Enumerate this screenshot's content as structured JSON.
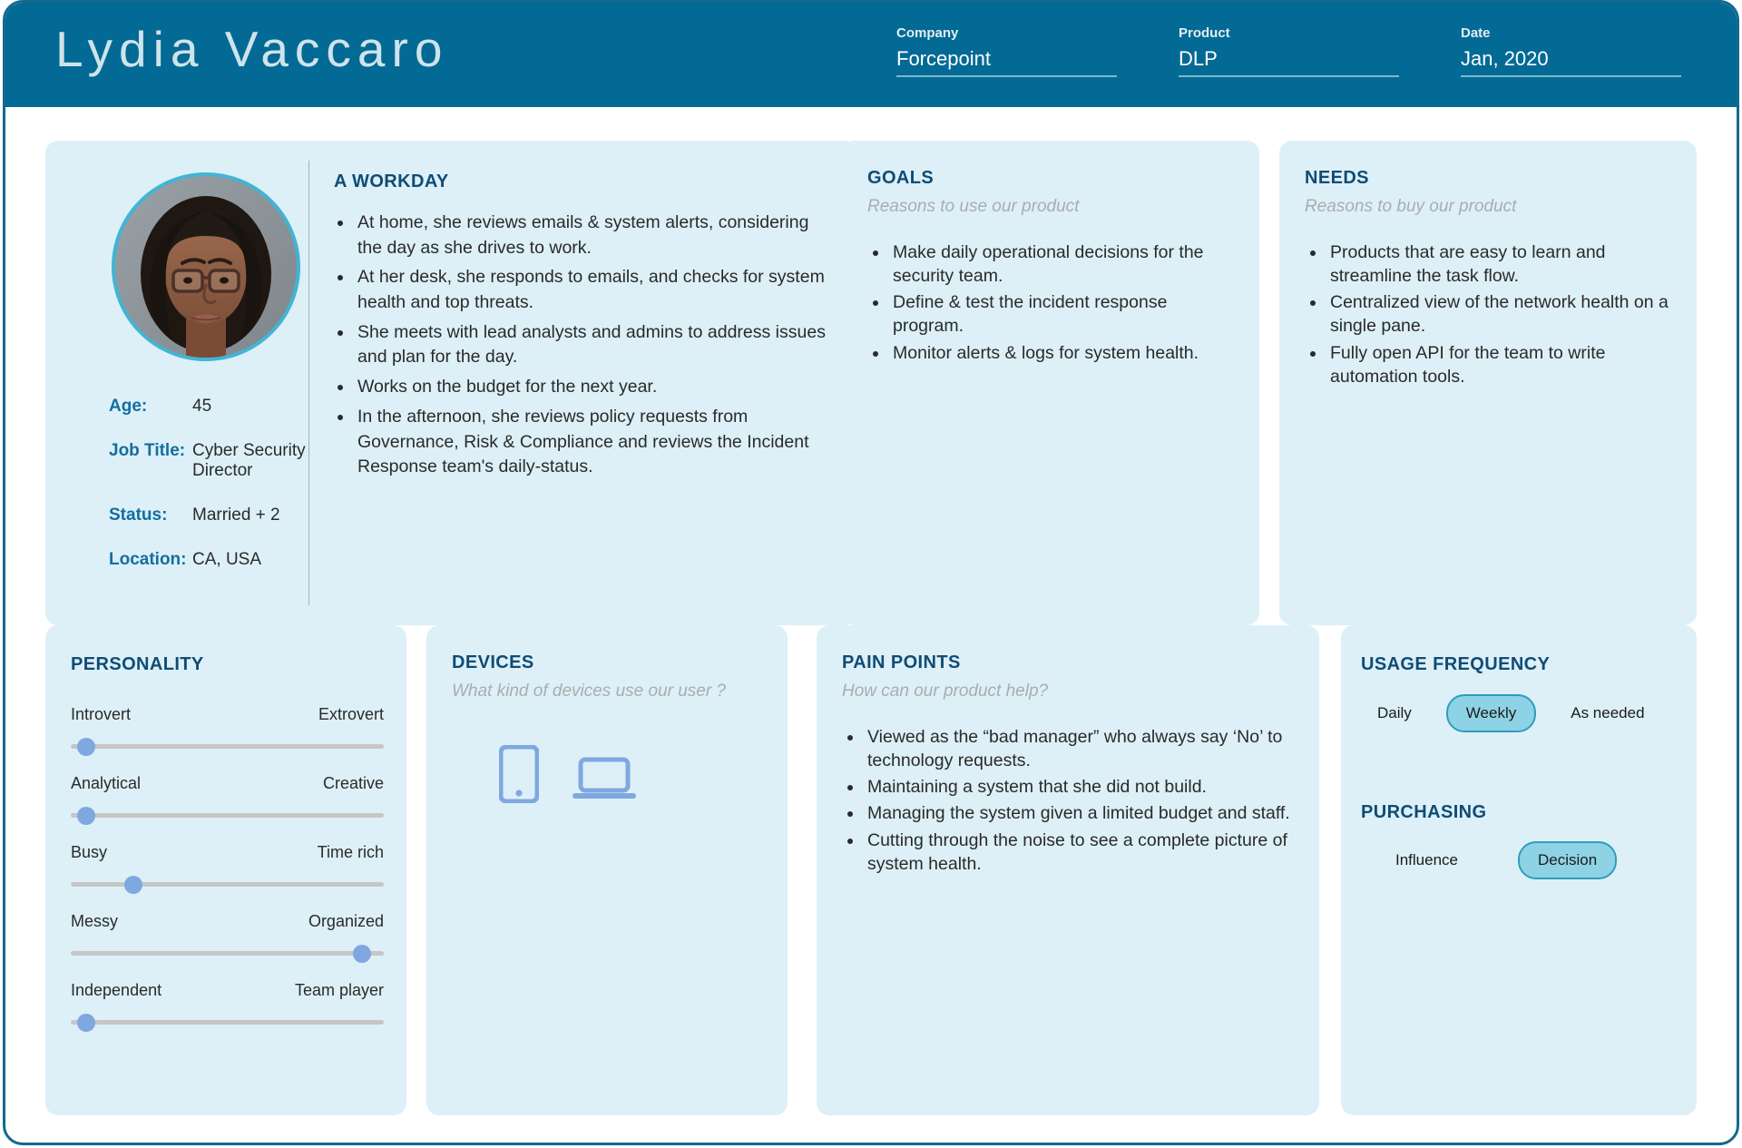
{
  "header": {
    "persona_name": "Lydia Vaccaro",
    "fields": [
      {
        "label": "Company",
        "value": "Forcepoint"
      },
      {
        "label": "Product",
        "value": "DLP"
      },
      {
        "label": "Date",
        "value": "Jan, 2020"
      }
    ]
  },
  "profile": {
    "avatar_alt": "persona-photo",
    "info": [
      {
        "key": "Age:",
        "value": "45"
      },
      {
        "key": "Job Title:",
        "value": "Cyber Security Director"
      },
      {
        "key": "Status:",
        "value": "Married + 2"
      },
      {
        "key": "Location:",
        "value": "CA, USA"
      }
    ]
  },
  "workday": {
    "title": "A WORKDAY",
    "items": [
      "At home, she reviews emails & system alerts, considering the day as she drives to work.",
      "At her desk, she responds to emails, and checks for system health and top threats.",
      "She meets with lead analysts and admins to address issues and plan for the day.",
      "Works on the budget for the next year.",
      "In the afternoon, she reviews policy requests from Governance, Risk & Compliance and reviews the Incident Response team's daily-status."
    ]
  },
  "goals": {
    "title": "GOALS",
    "subtitle": "Reasons to use our product",
    "items": [
      "Make daily operational decisions for the security team.",
      "Define & test the incident response program.",
      "Monitor alerts & logs for system health."
    ]
  },
  "needs": {
    "title": "NEEDS",
    "subtitle": "Reasons to buy our product",
    "items": [
      "Products that are easy to learn and streamline the task flow.",
      "Centralized view of the network health on a single pane.",
      "Fully open API for the team to write automation tools."
    ]
  },
  "personality": {
    "title": "PERSONALITY",
    "sliders": [
      {
        "left": "Introvert",
        "right": "Extrovert",
        "value": 5
      },
      {
        "left": "Analytical",
        "right": "Creative",
        "value": 5
      },
      {
        "left": "Busy",
        "right": "Time rich",
        "value": 20
      },
      {
        "left": "Messy",
        "right": "Organized",
        "value": 93
      },
      {
        "left": "Independent",
        "right": "Team player",
        "value": 5
      }
    ]
  },
  "devices": {
    "title": "DEVICES",
    "subtitle": "What kind of devices use our user ?",
    "icons": [
      "mobile-phone-icon",
      "laptop-icon"
    ]
  },
  "pain_points": {
    "title": "PAIN POINTS",
    "subtitle": "How can our product help?",
    "items": [
      "Viewed as the “bad manager” who always say ‘No’ to technology requests.",
      "Maintaining a system that she did not build.",
      "Managing the system given a limited budget and staff.",
      "Cutting through the noise to see a complete picture of system health."
    ]
  },
  "usage": {
    "title": "USAGE FREQUENCY",
    "options": [
      {
        "label": "Daily",
        "selected": false
      },
      {
        "label": "Weekly",
        "selected": true
      },
      {
        "label": "As needed",
        "selected": false
      }
    ]
  },
  "purchasing": {
    "title": "PURCHASING",
    "options": [
      {
        "label": "Influence",
        "selected": false
      },
      {
        "label": "Decision",
        "selected": true
      }
    ]
  },
  "colors": {
    "header_bg": "#026a94",
    "card_bg": "#ddf0f7",
    "title_blue": "#0f4c75",
    "accent_cyan": "#42b4d4",
    "chip_selected": "#8ed3e5",
    "slider_thumb": "#7fa8e0",
    "device_icon": "#7fa8e0"
  }
}
